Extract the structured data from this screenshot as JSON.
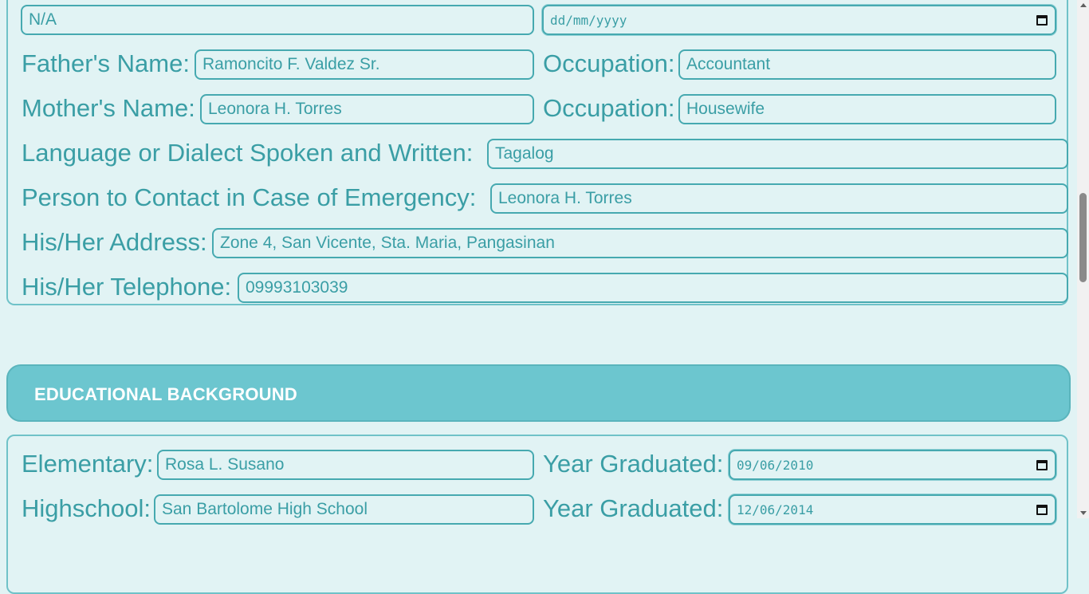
{
  "family": {
    "top_left_value": "N/A",
    "top_date_placeholder": "dd/mm/yyyy",
    "fathers_name_label": "Father's Name:",
    "fathers_name_value": "Ramoncito F. Valdez Sr.",
    "father_occupation_label": "Occupation:",
    "father_occupation_value": "Accountant",
    "mothers_name_label": "Mother's Name:",
    "mothers_name_value": "Leonora H. Torres",
    "mother_occupation_label": "Occupation:",
    "mother_occupation_value": "Housewife",
    "language_label": "Language or Dialect Spoken and Written:",
    "language_value": "Tagalog",
    "emergency_contact_label": "Person to Contact in Case of Emergency:",
    "emergency_contact_value": "Leonora H. Torres",
    "address_label": "His/Her Address:",
    "address_value": "Zone 4, San Vicente, Sta. Maria, Pangasinan",
    "telephone_label": "His/Her Telephone:",
    "telephone_value": "09993103039"
  },
  "education": {
    "header": "EDUCATIONAL BACKGROUND",
    "elementary_label": "Elementary:",
    "elementary_value": "Rosa L. Susano",
    "elementary_year_label": "Year Graduated:",
    "elementary_year_value": "09/06/2010",
    "highschool_label": "Highschool:",
    "highschool_value": "San Bartolome High School",
    "highschool_year_label": "Year Graduated:",
    "highschool_year_value": "12/06/2014"
  },
  "icons": {
    "date_picker": "calendar-icon"
  }
}
